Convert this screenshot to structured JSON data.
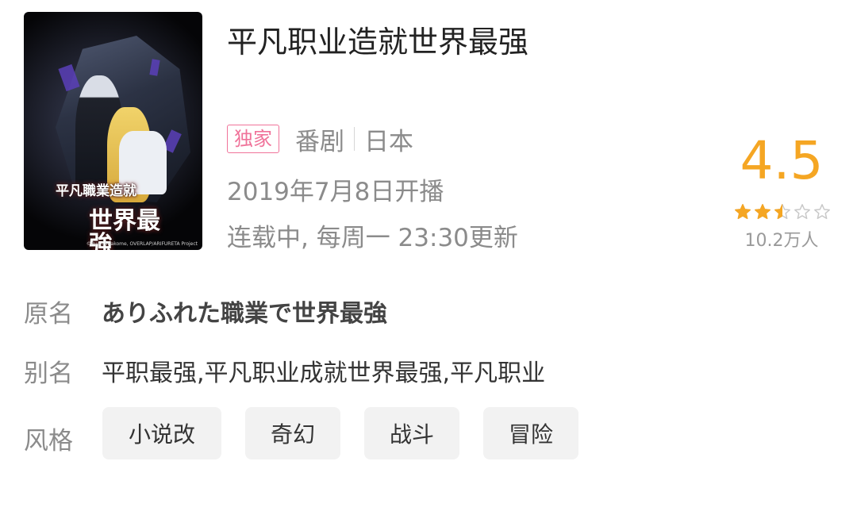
{
  "anime": {
    "title": "平凡职业造就世界最强",
    "badge": "独家",
    "category": "番剧",
    "region": "日本",
    "air_date": "2019年7月8日开播",
    "status": "连载中, 每周一 23:30更新",
    "cover": {
      "logo_line1": "平凡職業造就",
      "logo_line2": "世界最強",
      "credit": "©Ryo Shirakome, OVERLAP/ARIFURETA Project"
    }
  },
  "rating": {
    "score": "4.5",
    "stars": 2.5,
    "stars_max": 5,
    "votes": "10.2万人",
    "color": "#f5a623"
  },
  "info": {
    "original_label": "原名",
    "original_value": "ありふれた職業で世界最強",
    "alias_label": "别名",
    "alias_value": "平职最强,平凡职业成就世界最强,平凡职业",
    "genre_label": "风格",
    "genres": [
      "小说改",
      "奇幻",
      "战斗",
      "冒险"
    ]
  },
  "colors": {
    "badge": "#f0739a",
    "tag_bg": "#f2f2f2"
  }
}
